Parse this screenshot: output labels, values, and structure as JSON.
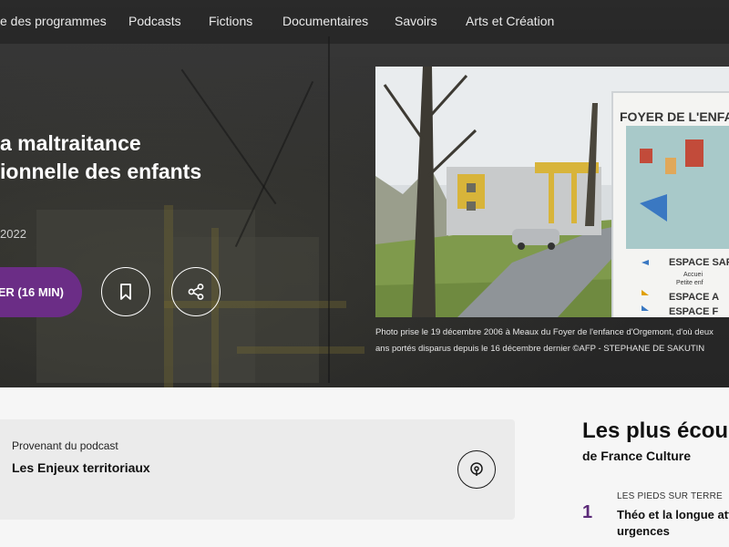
{
  "nav": {
    "items": [
      "e des programmes",
      "Podcasts",
      "Fictions",
      "Documentaires",
      "Savoirs",
      "Arts et Création"
    ]
  },
  "episode": {
    "title": "a maltraitance\nionnelle des enfants",
    "date": "2022",
    "play_label": "ER (16 MIN)",
    "bookmark_icon": "bookmark-icon",
    "share_icon": "share-icon"
  },
  "photo": {
    "sign_title": "FOYER DE L'ENFA",
    "sign_lines": [
      "ESPACE SAP",
      "Accuei",
      "Petite enf",
      "ESPACE A",
      "ESPACE F"
    ],
    "caption": "Photo prise le 19 décembre 2006 à Meaux du Foyer de l'enfance d'Orgemont, d'où deux ans portés disparus depuis le 16 décembre dernier ©AFP - STEPHANE DE SAKUTIN"
  },
  "podcast": {
    "kicker": "Provenant du podcast",
    "name": "Les Enjeux territoriaux",
    "icon": "podcast-icon"
  },
  "most_listened": {
    "title": "Les plus écou",
    "subtitle": "de France Culture",
    "items": [
      {
        "rank": "1",
        "kicker": "LES PIEDS SUR TERRE",
        "title": "Théo et la longue att urgences"
      }
    ]
  },
  "colors": {
    "accent": "#6b2d86",
    "rank": "#5b2a78"
  }
}
